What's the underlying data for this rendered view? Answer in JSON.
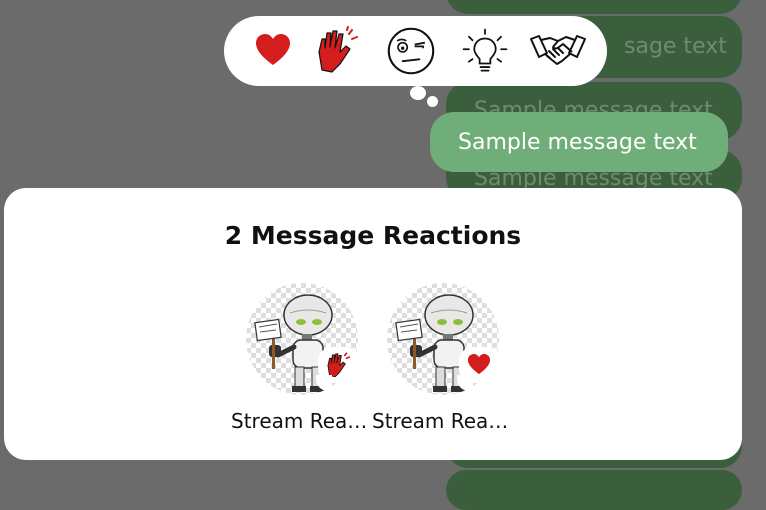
{
  "messages": {
    "sample_text": "Sample message text",
    "partial_text": "sage text"
  },
  "reaction_picker": {
    "reactions": [
      "love",
      "wave",
      "wut",
      "idea",
      "handshake"
    ]
  },
  "sheet": {
    "title": "2 Message Reactions",
    "users": [
      {
        "name": "Stream Reac…",
        "reaction": "wave",
        "avatar": "robot-avatar"
      },
      {
        "name": "Stream Reac…",
        "reaction": "love",
        "avatar": "robot-avatar"
      }
    ]
  },
  "colors": {
    "accent_red": "#d41d1d",
    "bubble_green": "#6fae78",
    "bubble_dark": "#3b5f3d"
  }
}
